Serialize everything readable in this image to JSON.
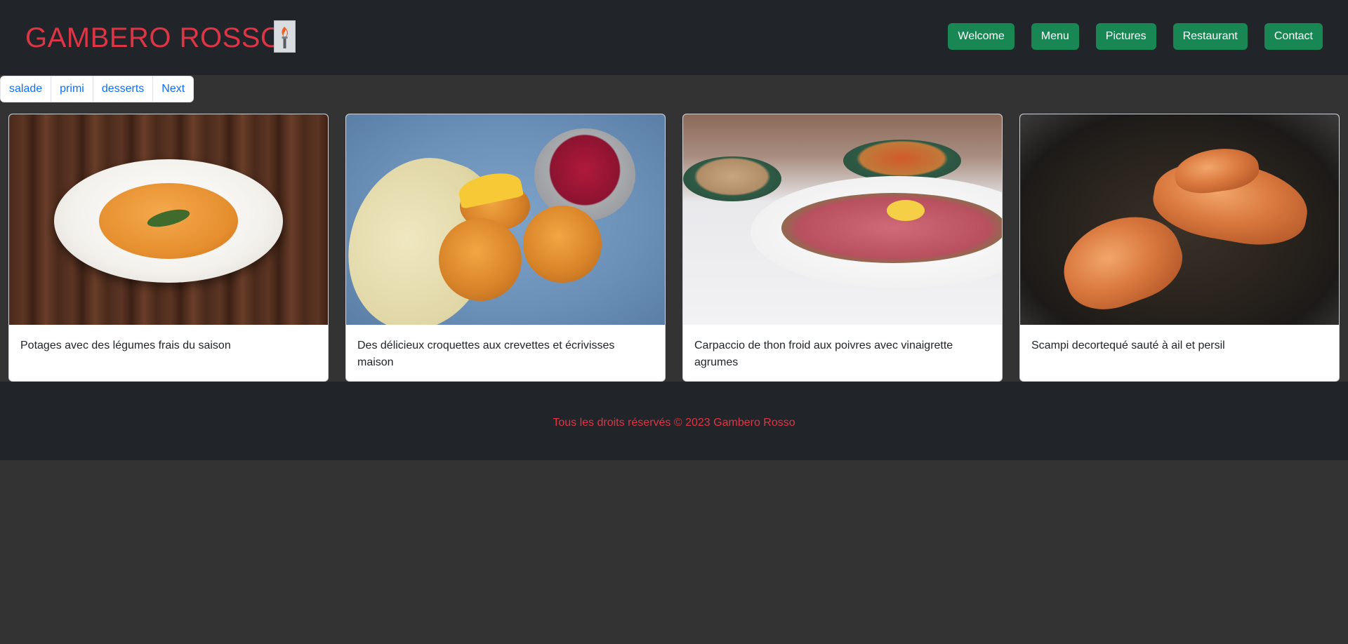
{
  "header": {
    "brand": "GAMBERO ROSSO",
    "logo_icon": "torch-logo-icon",
    "nav": [
      {
        "label": "Welcome"
      },
      {
        "label": "Menu"
      },
      {
        "label": "Pictures"
      },
      {
        "label": "Restaurant"
      },
      {
        "label": "Contact"
      }
    ]
  },
  "pagination": {
    "items": [
      {
        "label": "salade"
      },
      {
        "label": "primi"
      },
      {
        "label": "desserts"
      },
      {
        "label": "Next"
      }
    ]
  },
  "cards": [
    {
      "caption": "Potages avec des légumes frais du saison"
    },
    {
      "caption": "Des délicieux croquettes aux crevettes et écrivisses maison"
    },
    {
      "caption": "Carpaccio de thon froid aux poivres avec vinaigrette agrumes"
    },
    {
      "caption": "Scampi decortequé sauté à ail et persil"
    }
  ],
  "footer": {
    "text": "Tous les droits réservés © 2023 Gambero Rosso"
  },
  "colors": {
    "header_bg": "#212529",
    "page_bg": "#333333",
    "brand_red": "#dc3545",
    "nav_green": "#198754",
    "link_blue": "#0d6efd"
  }
}
